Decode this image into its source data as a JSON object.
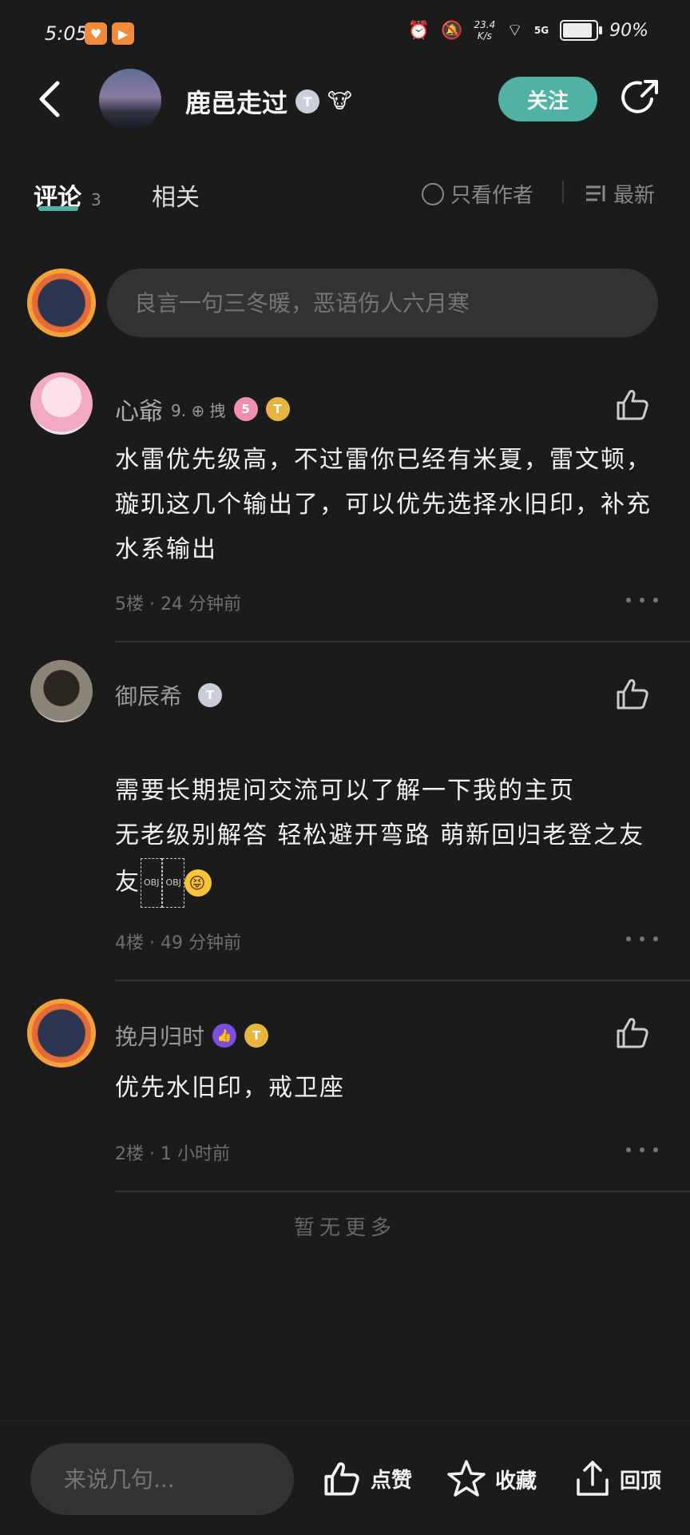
{
  "status": {
    "time": "5:05",
    "net_speed": "23.4",
    "net_unit": "K/s",
    "signal": "5G",
    "battery": "90%",
    "battery_level": 0.9
  },
  "header": {
    "author": "鹿邑走过",
    "author_level": "T",
    "follow_label": "关注"
  },
  "tabs": {
    "comments_label": "评论",
    "comments_count": "3",
    "related_label": "相关",
    "only_author_label": "只看作者",
    "sort_label": "最新"
  },
  "comment_input": {
    "placeholder": "良言一句三冬暖，恶语伤人六月寒"
  },
  "comments": [
    {
      "name": "心爺",
      "extra": "9. ⊕ 拽",
      "badge1": "5",
      "badge2": "T",
      "text": "水雷优先级高，不过雷你已经有米夏，雷文顿，璇玑这几个输出了，可以优先选择水旧印，补充水系输出",
      "floor": "5楼",
      "time": "24 分钟前"
    },
    {
      "name": "御辰希",
      "badge1": "T",
      "text_line1": "需要长期提问交流可以了解一下我的主页",
      "text_line2": "无老级别解答 轻松避开弯路 萌新回归老登之友",
      "obj": "OBJ",
      "floor": "4楼",
      "time": "49 分钟前"
    },
    {
      "name": "挽月归时",
      "badge2": "T",
      "text": "优先水旧印，戒卫座",
      "floor": "2楼",
      "time": "1 小时前"
    }
  ],
  "no_more": "暂无更多",
  "bottom": {
    "placeholder": "来说几句...",
    "like_label": "点赞",
    "collect_label": "收藏",
    "top_label": "回顶"
  }
}
